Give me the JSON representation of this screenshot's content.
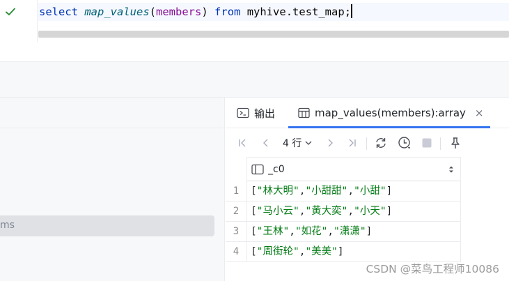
{
  "editor": {
    "status_icon": "check-icon",
    "code": {
      "kw_select": "select",
      "fn_name": "map_values",
      "paren_open": "(",
      "column": "members",
      "paren_close": ")",
      "kw_from": "from",
      "table": "myhive.test_map",
      "semicolon": ";"
    }
  },
  "left_panel": {
    "selected_item_label": "ms"
  },
  "results": {
    "tabs": [
      {
        "icon": "console-icon",
        "label": "输出"
      },
      {
        "icon": "table-icon",
        "label": "map_values(members):array",
        "close_label": "×"
      }
    ],
    "toolbar": {
      "row_count": "4 行",
      "icons": [
        "first-page-icon",
        "prev-page-icon",
        "next-page-icon",
        "last-page-icon",
        "refresh-icon",
        "history-icon",
        "stop-icon",
        "pin-icon"
      ]
    },
    "column_header": "_c0",
    "rows": [
      {
        "num": "1",
        "open": "[",
        "items": [
          "\"林大明\"",
          "\"小甜甜\"",
          "\"小甜\""
        ],
        "close": "]"
      },
      {
        "num": "2",
        "open": "[",
        "items": [
          "\"马小云\"",
          "\"黄大奕\"",
          "\"小天\""
        ],
        "close": "]"
      },
      {
        "num": "3",
        "open": "[",
        "items": [
          "\"王林\"",
          "\"如花\"",
          "\"潇潇\""
        ],
        "close": "]"
      },
      {
        "num": "4",
        "open": "[",
        "items": [
          "\"周街轮\"",
          "\"美美\""
        ],
        "close": "]"
      }
    ]
  },
  "watermark": "CSDN @菜鸟工程师10086",
  "colors": {
    "keyword": "#0033b3",
    "function": "#00627a",
    "column": "#871094",
    "string": "#067d17",
    "accent": "#3574f0",
    "success": "#2f8f3c"
  }
}
